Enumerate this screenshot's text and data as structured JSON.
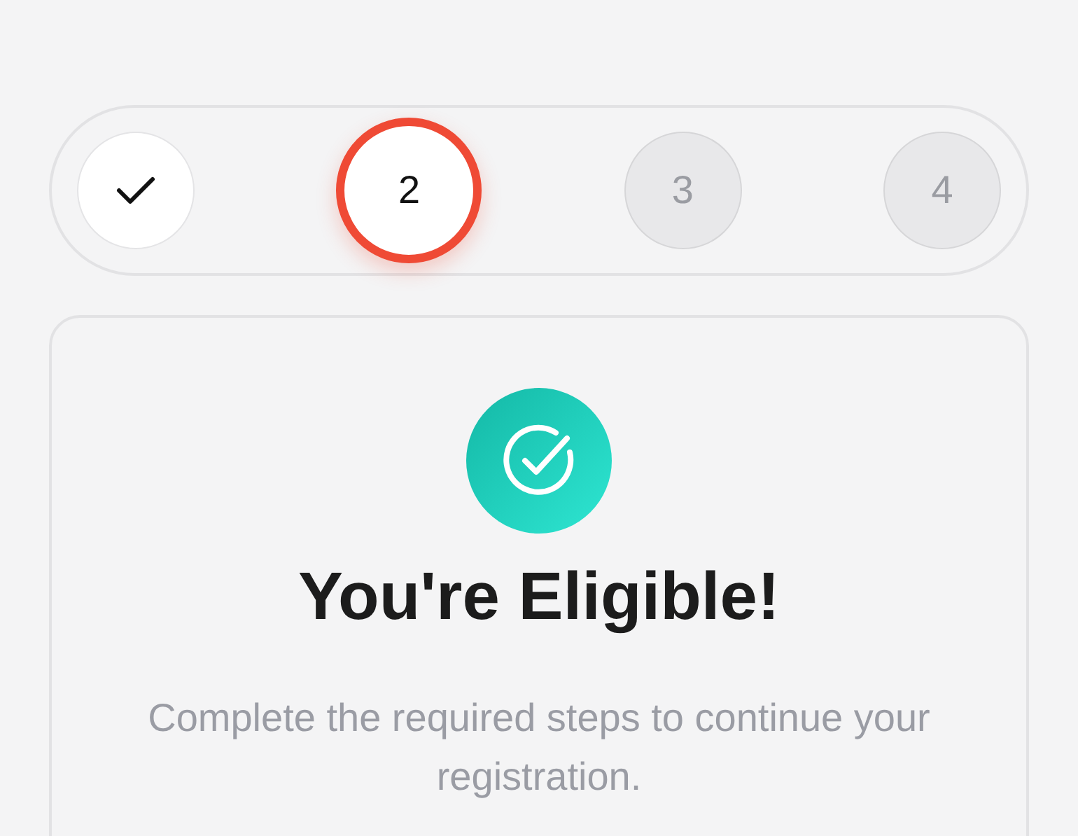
{
  "steps": [
    {
      "kind": "done"
    },
    {
      "kind": "current",
      "label": "2"
    },
    {
      "kind": "upcoming",
      "label": "3"
    },
    {
      "kind": "upcoming",
      "label": "4"
    }
  ],
  "card": {
    "title": "You're Eligible!",
    "message": "Complete the required steps to continue your registration."
  }
}
